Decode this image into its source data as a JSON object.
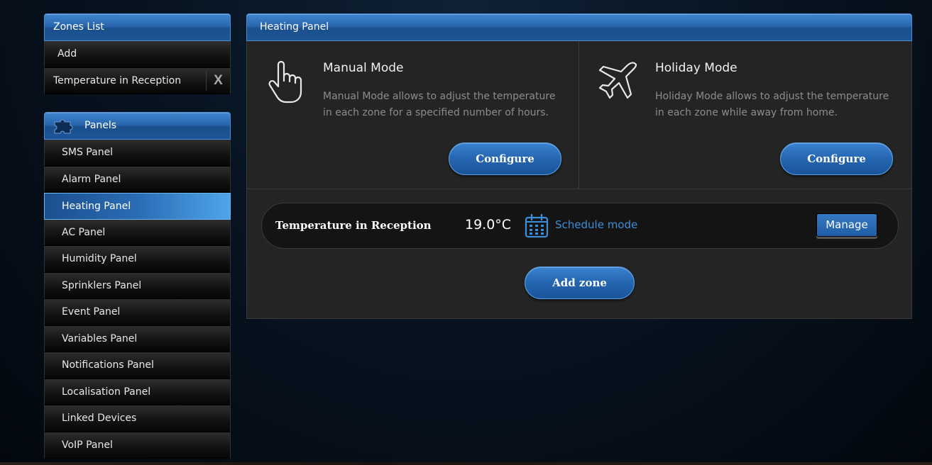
{
  "zones_list": {
    "title": "Zones List",
    "add_label": "Add",
    "zones": [
      {
        "name": "Temperature in Reception",
        "remove_label": "X"
      }
    ]
  },
  "panels": {
    "title": "Panels",
    "items": [
      {
        "label": "SMS Panel",
        "active": false
      },
      {
        "label": "Alarm Panel",
        "active": false
      },
      {
        "label": "Heating Panel",
        "active": true
      },
      {
        "label": "AC Panel",
        "active": false
      },
      {
        "label": "Humidity Panel",
        "active": false
      },
      {
        "label": "Sprinklers Panel",
        "active": false
      },
      {
        "label": "Event Panel",
        "active": false
      },
      {
        "label": "Variables Panel",
        "active": false
      },
      {
        "label": "Notifications Panel",
        "active": false
      },
      {
        "label": "Localisation Panel",
        "active": false
      },
      {
        "label": "Linked Devices",
        "active": false
      },
      {
        "label": "VoIP Panel",
        "active": false
      }
    ]
  },
  "heating_panel": {
    "title": "Heating Panel",
    "manual_mode": {
      "icon": "hand-pointer-icon",
      "title": "Manual Mode",
      "description": "Manual Mode allows to adjust the temperature in each zone for a specified number of hours.",
      "button_label": "Configure"
    },
    "holiday_mode": {
      "icon": "airplane-icon",
      "title": "Holiday Mode",
      "description": "Holiday Mode allows to adjust the temperature in each zone while away from home.",
      "button_label": "Configure"
    },
    "zone": {
      "name": "Temperature in Reception",
      "temperature": "19.0°C",
      "mode_icon": "calendar-icon",
      "mode_label": "Schedule mode",
      "manage_label": "Manage"
    },
    "add_zone_label": "Add zone"
  },
  "colors": {
    "accent_blue": "#2a6cb5",
    "link_blue": "#3d8ed8",
    "panel_bg": "#242424"
  }
}
